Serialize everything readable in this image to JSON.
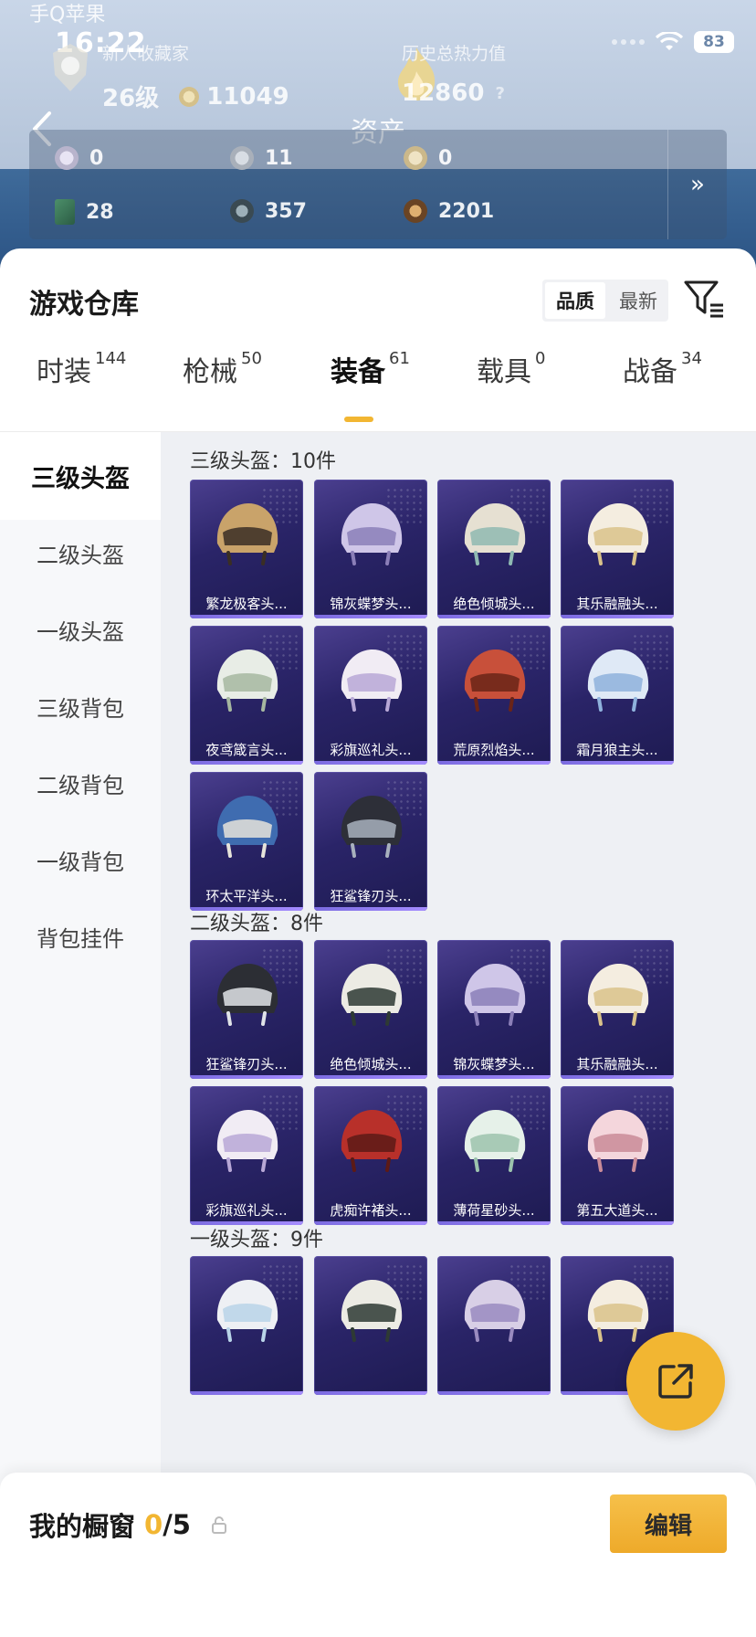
{
  "watermark": "手Q苹果",
  "status": {
    "time": "16:22",
    "battery": "83"
  },
  "profile": {
    "title_label": "新人收藏家",
    "level": "26级",
    "points": "11049",
    "heat_label": "历史总热力值",
    "heat_value": "12860",
    "help": "?"
  },
  "nav": {
    "title": "资产"
  },
  "assets": {
    "row1": [
      {
        "icon": "silver-token-icon",
        "value": "0"
      },
      {
        "icon": "silver-coin-icon",
        "value": "11"
      },
      {
        "icon": "gold-coin-icon",
        "value": "0"
      }
    ],
    "row2": [
      {
        "icon": "green-card-icon",
        "value": "28"
      },
      {
        "icon": "dark-coin-icon",
        "value": "357"
      },
      {
        "icon": "bronze-coin-icon",
        "value": "2201"
      }
    ],
    "more": "»"
  },
  "warehouse": {
    "title": "游戏仓库",
    "sort": {
      "quality": "品质",
      "newest": "最新"
    },
    "tabs": [
      {
        "label": "时装",
        "count": "144"
      },
      {
        "label": "枪械",
        "count": "50"
      },
      {
        "label": "装备",
        "count": "61"
      },
      {
        "label": "载具",
        "count": "0"
      },
      {
        "label": "战备",
        "count": "34"
      }
    ],
    "sidebar": [
      "三级头盔",
      "二级头盔",
      "一级头盔",
      "三级背包",
      "二级背包",
      "一级背包",
      "背包挂件"
    ],
    "sections": [
      {
        "title": "三级头盔：10件",
        "items": [
          "繁龙极客头...",
          "锦灰蝶梦头...",
          "绝色倾城头...",
          "其乐融融头...",
          "夜鸢箴言头...",
          "彩旗巡礼头...",
          "荒原烈焰头...",
          "霜月狼主头...",
          "环太平洋头...",
          "狂鲨锋刃头..."
        ]
      },
      {
        "title": "二级头盔：8件",
        "items": [
          "狂鲨锋刃头...",
          "绝色倾城头...",
          "锦灰蝶梦头...",
          "其乐融融头...",
          "彩旗巡礼头...",
          "虎痴许褚头...",
          "薄荷星砂头...",
          "第五大道头..."
        ]
      },
      {
        "title": "一级头盔：9件",
        "items": [
          "",
          "",
          "",
          ""
        ]
      }
    ]
  },
  "showcase": {
    "label": "我的橱窗",
    "current": "0",
    "total": "/5",
    "edit": "编辑"
  },
  "colors": {
    "accent": "#f2b632",
    "tile_bg": "#2a2468"
  }
}
